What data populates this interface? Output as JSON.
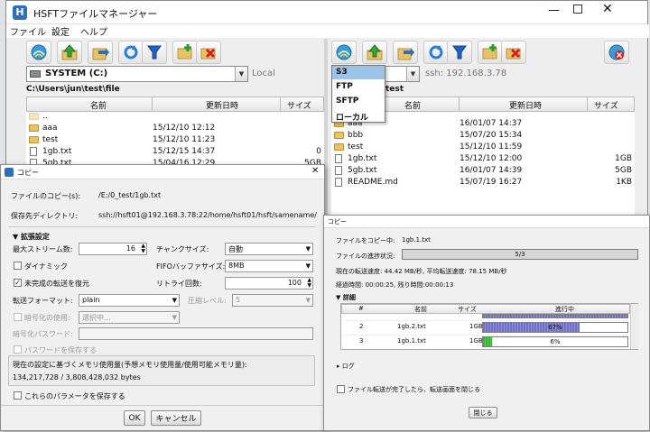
{
  "main_window": {
    "title": "HSFTファイルマネージャー",
    "menu": [
      "ファイル",
      "設定",
      "ヘルプ"
    ],
    "left": {
      "drive": "SYSTEM (C:)",
      "location": "Local",
      "path": "C:\\Users\\jun\\test\\file",
      "columns": [
        "名前",
        "更新日時",
        "サイズ"
      ],
      "rows": [
        {
          "name": "..",
          "date": "",
          "size": "",
          "icon": "parent"
        },
        {
          "name": "aaa",
          "date": "15/12/10 12:12",
          "size": "",
          "icon": "folder"
        },
        {
          "name": "test",
          "date": "15/12/10 11:23",
          "size": "",
          "icon": "folder"
        },
        {
          "name": "1gb.txt",
          "date": "15/12/15 14:37",
          "size": "0",
          "icon": "file"
        },
        {
          "name": "5gb.txt",
          "date": "15/04/16 12:29",
          "size": "5GB",
          "icon": "file"
        }
      ]
    },
    "right": {
      "location": "ssh: 192.168.3.78",
      "path_tail": "test",
      "dropdown_options": [
        "S3",
        "FTP",
        "SFTP",
        "ローカル"
      ],
      "columns": [
        "名前",
        "更新日時",
        "サイズ"
      ],
      "rows": [
        {
          "name": "aaa",
          "date": "16/01/07 14:37",
          "size": "",
          "icon": "folder"
        },
        {
          "name": "bbb",
          "date": "15/07/20 15:34",
          "size": "",
          "icon": "folder"
        },
        {
          "name": "test",
          "date": "15/12/10 11:59",
          "size": "",
          "icon": "folder"
        },
        {
          "name": "1gb.txt",
          "date": "15/12/10 12:00",
          "size": "1GB",
          "icon": "file"
        },
        {
          "name": "5gb.txt",
          "date": "16/01/07 14:39",
          "size": "5GB",
          "icon": "file"
        },
        {
          "name": "README.md",
          "date": "15/07/19 16:27",
          "size": "1KB",
          "icon": "file"
        }
      ]
    }
  },
  "copy_dialog": {
    "title": "コピー",
    "file_label": "ファイルのコピー(s):",
    "file_value": "/E:/0_test/1gb.txt",
    "dest_label": "保存先ディレクトリ:",
    "dest_value": "ssh://hsft01@192.168.3.78:22/home/hsft01/hsft/samename/",
    "advanced_label": "▼ 拡張設定",
    "max_streams_label": "最大ストリーム数:",
    "max_streams_value": "16",
    "chunk_label": "チャンクサイズ:",
    "chunk_value": "自動",
    "dynamic_label": "ダイナミック",
    "fifo_label": "FIFOバッファサイズ:",
    "fifo_value": "8MB",
    "resume_label": "未完成の転送を復元",
    "retry_label": "リトライ回数:",
    "retry_value": "100",
    "format_label": "転送フォーマット:",
    "format_value": "plain",
    "compress_label": "圧縮レベル:",
    "compress_value": "5",
    "encrypt_label": "暗号化の使用:",
    "encrypt_value": "選択中...",
    "password_label": "暗号化パスワード:",
    "save_password_label": "パスワードを保存する",
    "memory_label": "現在の設定に基づくメモリ使用量(予想メモリ使用量/使用可能メモリ量):",
    "memory_value": "134,217,728 / 3,808,428,032 bytes",
    "save_params_label": "これらのパラメータを保存する",
    "ok_label": "OK",
    "cancel_label": "キャンセル"
  },
  "progress_dialog": {
    "title": "コピー",
    "copying_label": "ファイルをコピー中:",
    "copying_value": "1gb.1.txt",
    "progress_label": "ファイルの進捗状況:",
    "progress_text": "5/3",
    "speed_text": "現在の転送速度: 44.42 MB/秒, 平均転送速度: 78.15 MB/秒",
    "time_text": "経過時間: 00:00:25, 残り時間:00:00:13",
    "details_label": "▼ 詳細",
    "columns": [
      "#",
      "名前",
      "サイズ",
      "進行中"
    ],
    "rows": [
      {
        "num": "",
        "name": "",
        "size": "",
        "percent": "",
        "progress": 1.0
      },
      {
        "num": "2",
        "name": "1gb.2.txt",
        "size": "1GB",
        "percent": "67%",
        "progress": 0.67
      },
      {
        "num": "3",
        "name": "1gb.1.txt",
        "size": "1GB",
        "percent": "6%",
        "progress": 0.06
      }
    ],
    "log_label": "▸ ログ",
    "close_after_label": "ファイル転送が完了したら、転送画面を閉じる",
    "close_button": "閉じる"
  }
}
